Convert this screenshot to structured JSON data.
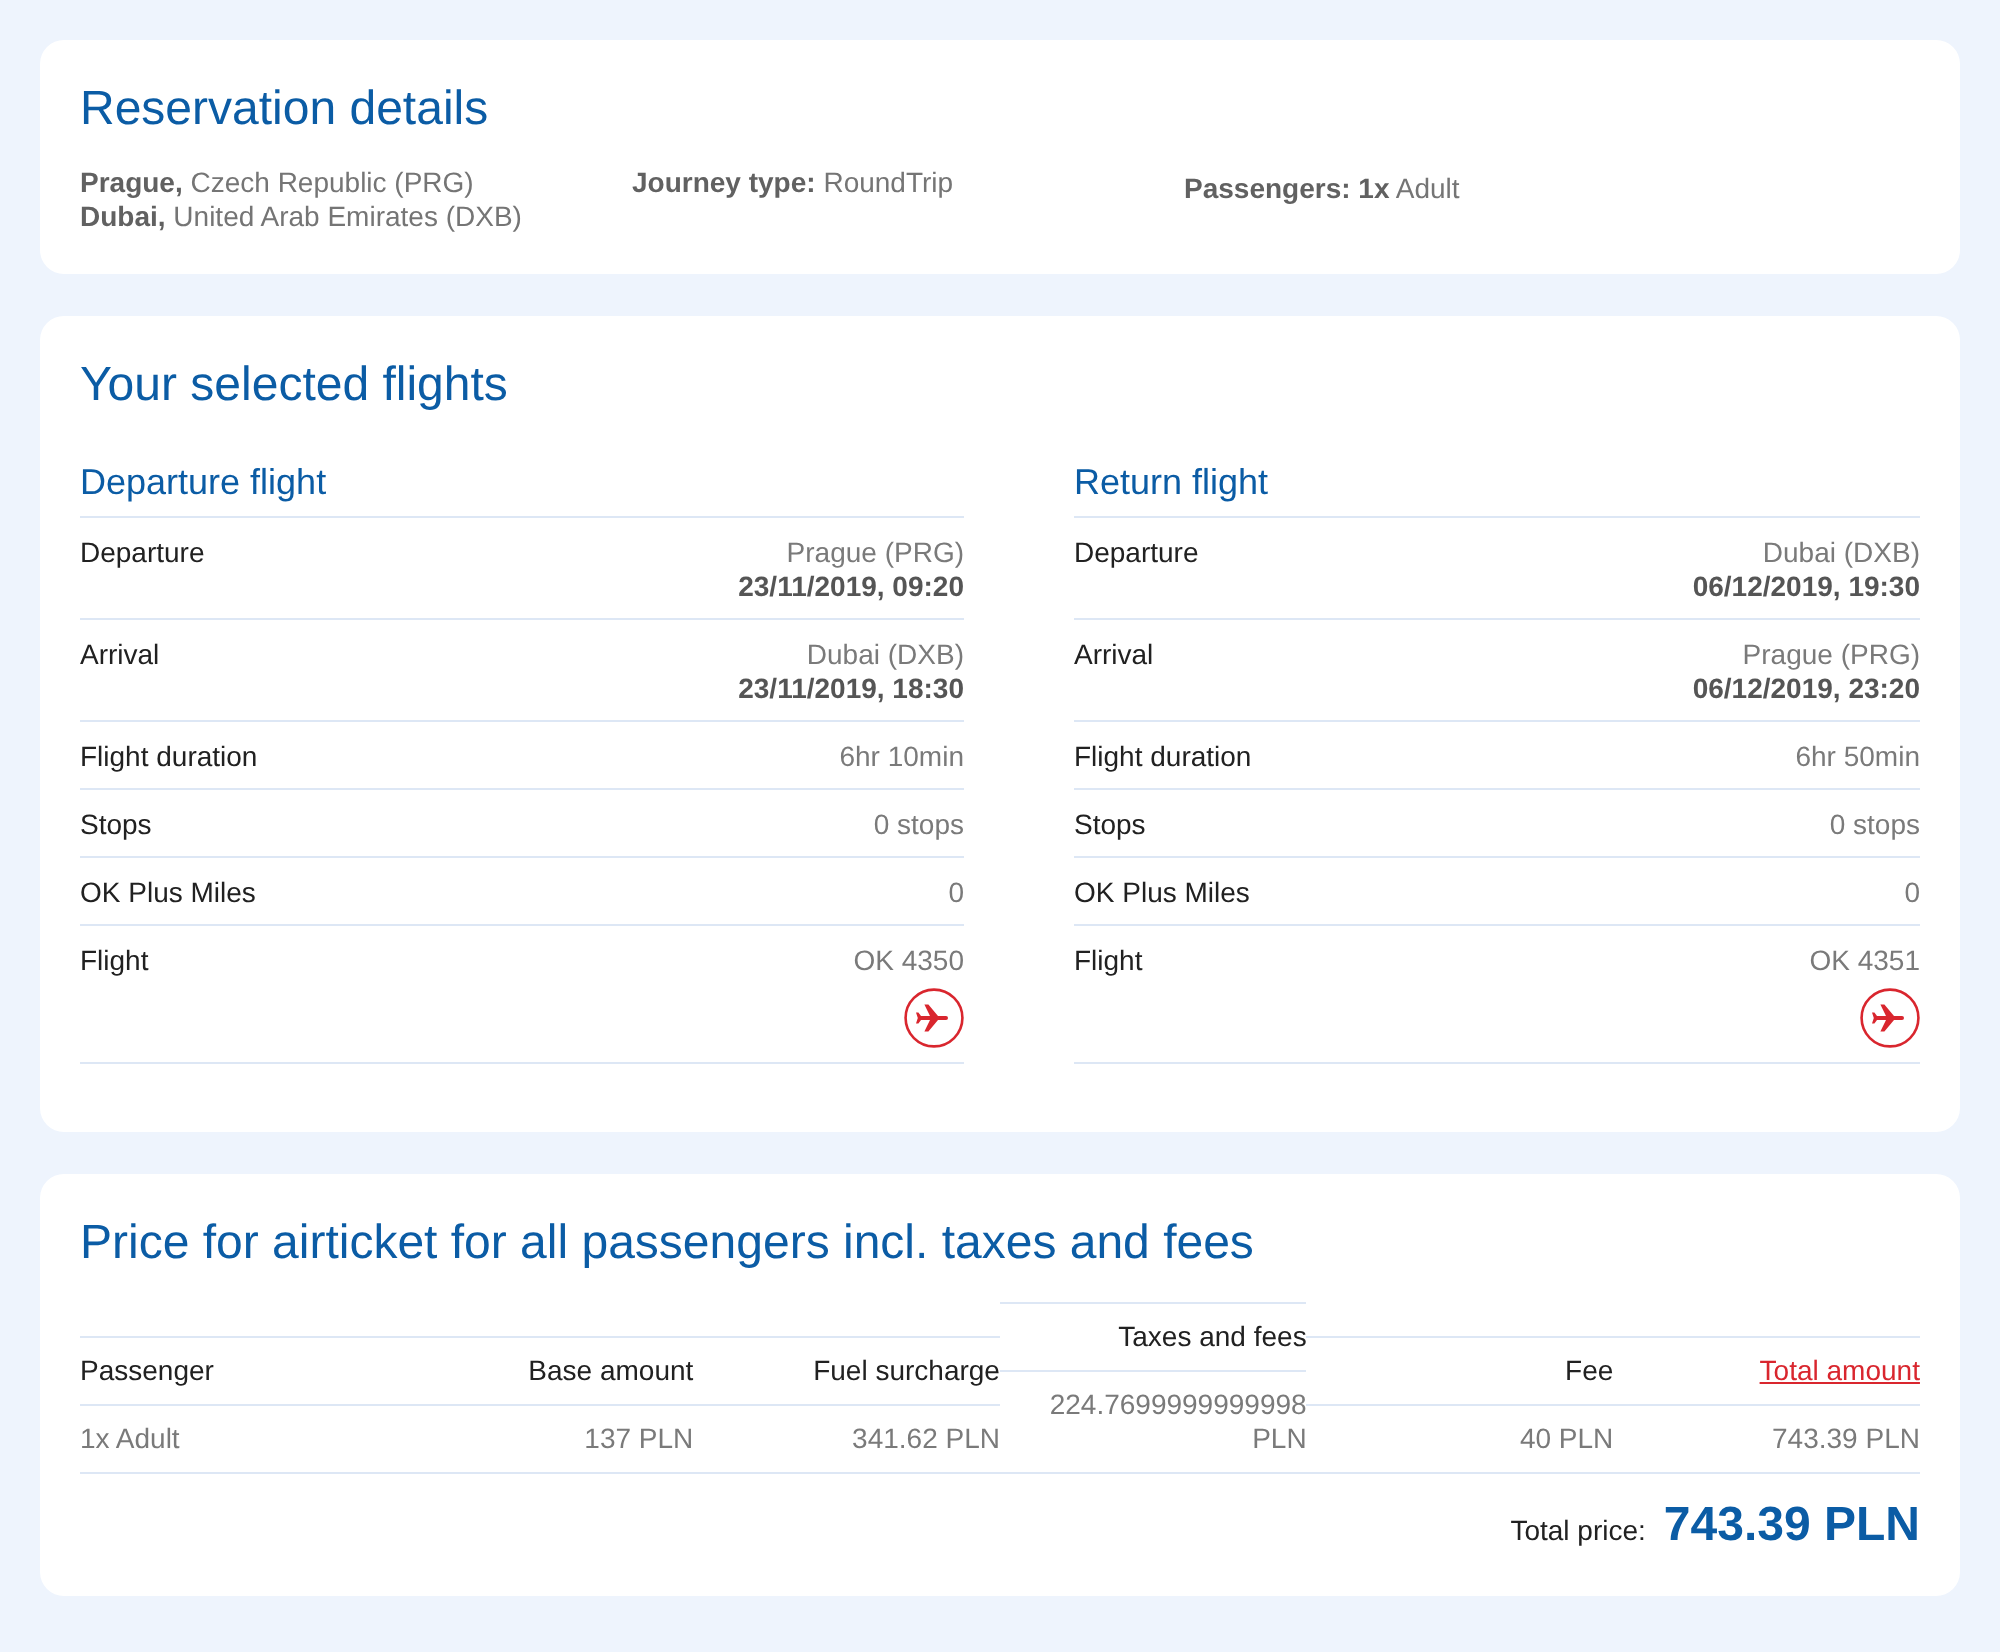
{
  "reservation": {
    "title": "Reservation details",
    "route": [
      "**Prague,** Czech Republic (PRG)",
      "**Dubai,** United Arab Emirates (DXB)"
    ],
    "journey": "**Journey type:** RoundTrip",
    "passengers": "**Passengers: 1x** Adult"
  },
  "flights": {
    "title": "Your selected flights",
    "sections": [
      {
        "title": "Departure flight",
        "rows": [
          {
            "kind": "place_time",
            "label": "Departure",
            "place": "Prague (PRG)",
            "time": "23/11/2019, 09:20"
          },
          {
            "kind": "place_time",
            "label": "Arrival",
            "place": "Dubai (DXB)",
            "time": "23/11/2019, 18:30"
          },
          {
            "kind": "text",
            "label": "Flight duration",
            "value": "6hr 10min"
          },
          {
            "kind": "text",
            "label": "Stops",
            "value": "0 stops"
          },
          {
            "kind": "text",
            "label": "OK Plus Miles",
            "value": "0"
          },
          {
            "kind": "flight",
            "label": "Flight",
            "value": "OK 4350"
          }
        ]
      },
      {
        "title": "Return flight",
        "rows": [
          {
            "kind": "place_time",
            "label": "Departure",
            "place": "Dubai (DXB)",
            "time": "06/12/2019, 19:30"
          },
          {
            "kind": "place_time",
            "label": "Arrival",
            "place": "Prague (PRG)",
            "time": "06/12/2019, 23:20"
          },
          {
            "kind": "text",
            "label": "Flight duration",
            "value": "6hr 50min"
          },
          {
            "kind": "text",
            "label": "Stops",
            "value": "0 stops"
          },
          {
            "kind": "text",
            "label": "OK Plus Miles",
            "value": "0"
          },
          {
            "kind": "flight",
            "label": "Flight",
            "value": "OK 4351"
          }
        ]
      }
    ]
  },
  "price": {
    "title": "Price for airticket for all passengers incl. taxes and fees",
    "columns": [
      {
        "kind": "text",
        "label": "Passenger"
      },
      {
        "kind": "text",
        "label": "Base amount"
      },
      {
        "kind": "text",
        "label": "Fuel surcharge"
      },
      {
        "kind": "text",
        "label": "Taxes and fees"
      },
      {
        "kind": "text",
        "label": "Fee"
      },
      {
        "kind": "link",
        "label": "Total amount"
      }
    ],
    "rows": [
      {
        "cells": [
          "1x Adult",
          "137 PLN",
          "341.62 PLN",
          "224.7699999999998 PLN",
          "40 PLN",
          "743.39 PLN"
        ]
      }
    ],
    "total": {
      "label": "Total price:",
      "value": "743.39 PLN"
    }
  }
}
